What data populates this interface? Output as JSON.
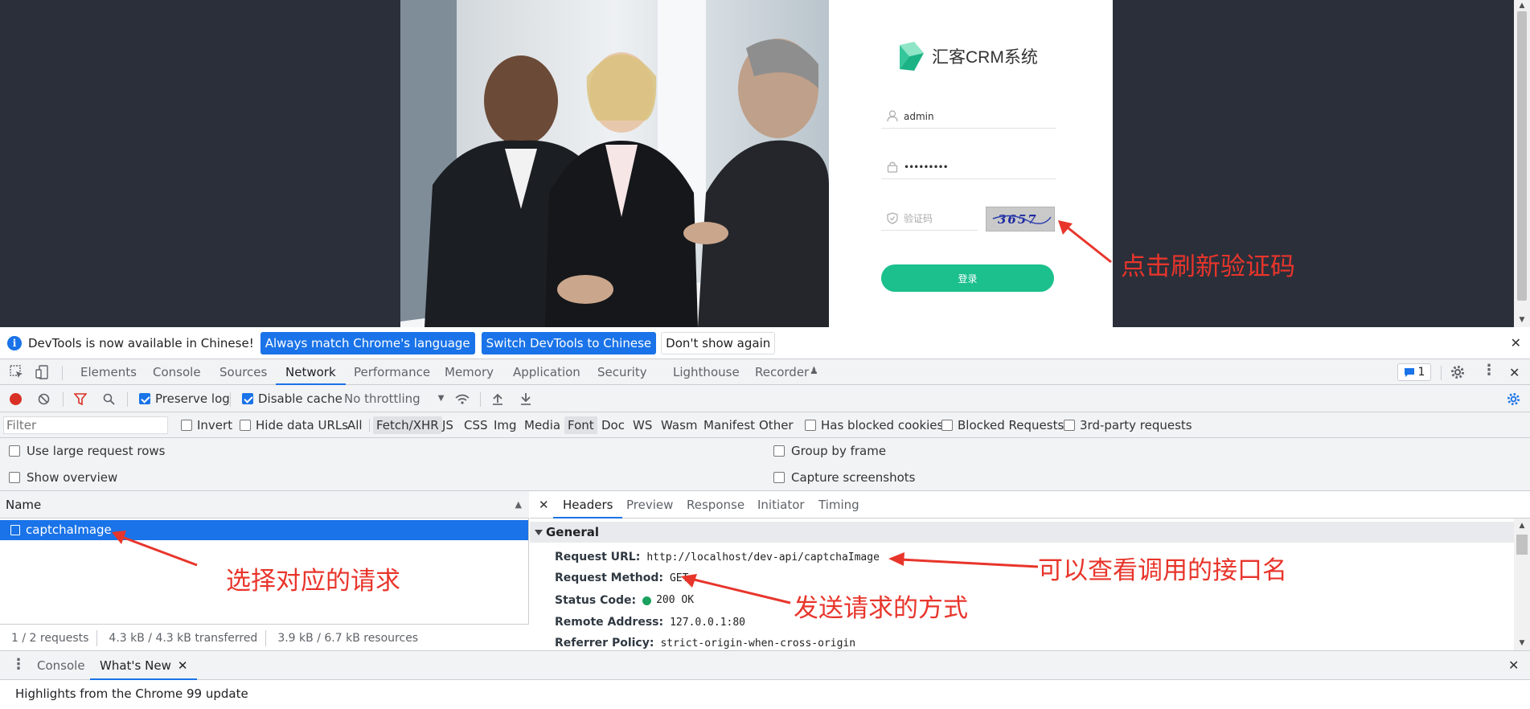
{
  "login": {
    "app_name": "汇客CRM系统",
    "username_value": "admin",
    "password_value": "•••••••••",
    "captcha_placeholder": "验证码",
    "captcha_text": "3657",
    "submit_label": "登录"
  },
  "annotations": {
    "refresh_captcha": "点击刷新验证码",
    "select_request": "选择对应的请求",
    "view_api_name": "可以查看调用的接口名",
    "request_method_note": "发送请求的方式"
  },
  "infobar": {
    "message": "DevTools is now available in Chinese!",
    "btn_match": "Always match Chrome's language",
    "btn_switch": "Switch DevTools to Chinese",
    "btn_dismiss": "Don't show again"
  },
  "tabs": {
    "elements": "Elements",
    "console": "Console",
    "sources": "Sources",
    "network": "Network",
    "performance": "Performance",
    "memory": "Memory",
    "application": "Application",
    "security": "Security",
    "lighthouse": "Lighthouse",
    "recorder": "Recorder",
    "issues_count": "1"
  },
  "toolbar": {
    "preserve_log": "Preserve log",
    "disable_cache": "Disable cache",
    "throttling": "No throttling"
  },
  "filterbar": {
    "filter_placeholder": "Filter",
    "invert": "Invert",
    "hide_data_urls": "Hide data URLs",
    "types": [
      "All",
      "Fetch/XHR",
      "JS",
      "CSS",
      "Img",
      "Media",
      "Font",
      "Doc",
      "WS",
      "Wasm",
      "Manifest",
      "Other"
    ],
    "has_blocked_cookies": "Has blocked cookies",
    "blocked_requests": "Blocked Requests",
    "third_party": "3rd-party requests"
  },
  "options": {
    "large_rows": "Use large request rows",
    "show_overview": "Show overview",
    "group_by_frame": "Group by frame",
    "capture_screenshots": "Capture screenshots"
  },
  "requests": {
    "name_header": "Name",
    "selected_row": "captchaImage",
    "status_count": "1 / 2 requests",
    "status_transferred": "4.3 kB / 4.3 kB transferred",
    "status_resources": "3.9 kB / 6.7 kB resources"
  },
  "details": {
    "tabs": [
      "Headers",
      "Preview",
      "Response",
      "Initiator",
      "Timing"
    ],
    "general_title": "General",
    "rows": [
      {
        "key": "Request URL:",
        "value": "http://localhost/dev-api/captchaImage"
      },
      {
        "key": "Request Method:",
        "value": "GET"
      },
      {
        "key": "Status Code:",
        "value": "200 OK"
      },
      {
        "key": "Remote Address:",
        "value": "127.0.0.1:80"
      },
      {
        "key": "Referrer Policy:",
        "value": "strict-origin-when-cross-origin"
      }
    ]
  },
  "drawer": {
    "console_tab": "Console",
    "whats_new_tab": "What's New",
    "highlight": "Highlights from the Chrome 99 update"
  },
  "colors": {
    "accent": "#1a73e8",
    "login_button": "#1bc08c",
    "annotation": "#e8352b",
    "page_background": "#2b2f3a"
  }
}
